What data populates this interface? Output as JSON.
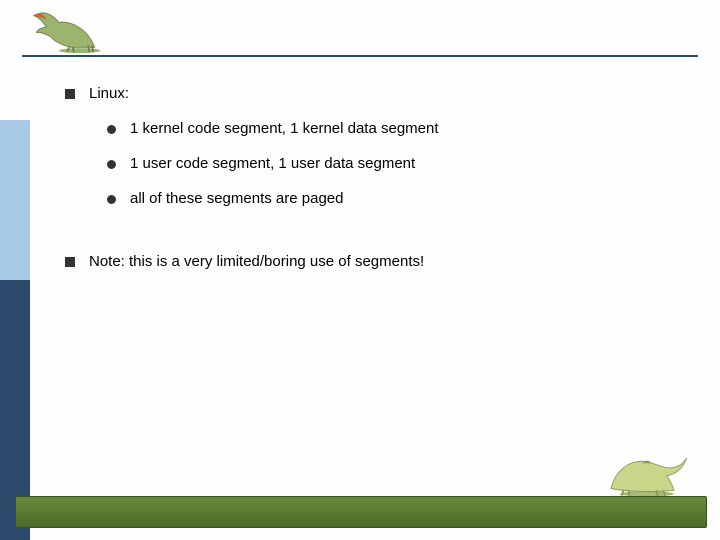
{
  "bullets": {
    "a": "Linux:",
    "a1": "1 kernel code segment, 1 kernel data segment",
    "a2": "1 user code segment, 1 user data segment",
    "a3": "all of these segments are paged",
    "b": "Note:  this is a very limited/boring use of segments!"
  }
}
